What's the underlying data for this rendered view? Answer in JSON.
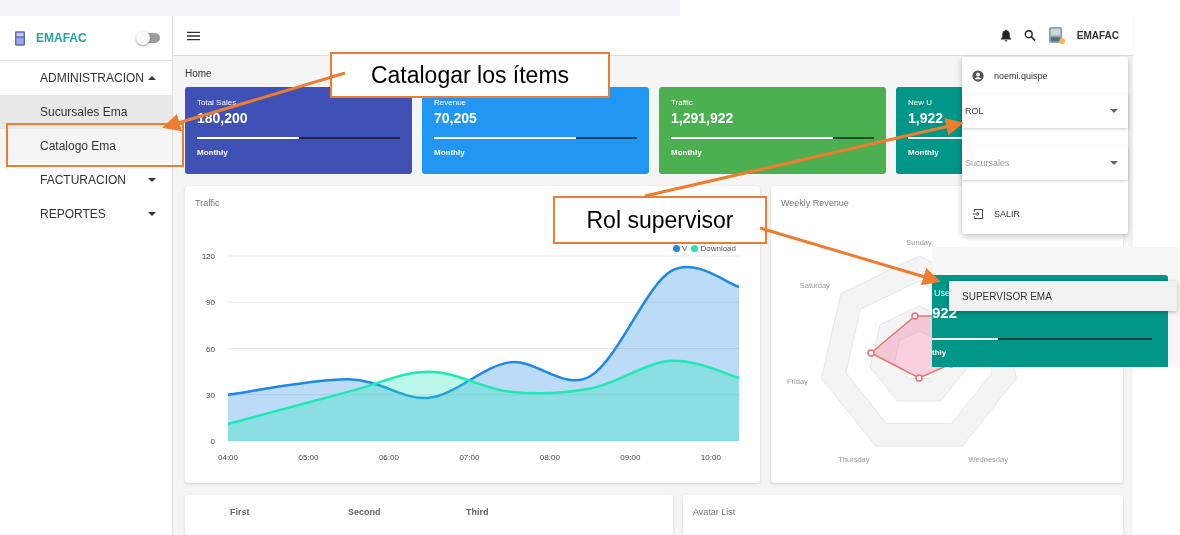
{
  "sidebar": {
    "brand": "EMAFAC",
    "toggle_on": false,
    "items": [
      {
        "label": "ADMINISTRACION",
        "expanded": true,
        "children": [
          {
            "label": "Sucursales Ema",
            "selected": true
          },
          {
            "label": "Catalogo Ema",
            "selected": false
          }
        ]
      },
      {
        "label": "FACTURACION",
        "expanded": false
      },
      {
        "label": "REPORTES",
        "expanded": false
      }
    ]
  },
  "topbar": {
    "user_label": "EMAFAC"
  },
  "breadcrumb": "Home",
  "stat_cards": [
    {
      "title": "Total Sales",
      "value": "180,200",
      "footer": "Monthly",
      "level": 0.5,
      "color": "#3f51b5"
    },
    {
      "title": "Revenue",
      "value": "70,205",
      "footer": "Monthly",
      "level": 0.7,
      "color": "#2196f3"
    },
    {
      "title": "Traffic",
      "value": "1,291,922",
      "footer": "Monthly",
      "level": 0.8,
      "color": "#4caf50"
    },
    {
      "title": "New U",
      "value": "1,922",
      "footer": "Monthly",
      "level": 0.5,
      "color": "#009688"
    }
  ],
  "traffic_card": {
    "title": "Traffic",
    "chart_data": {
      "type": "area",
      "x": [
        4,
        5.5,
        6.5,
        7.5,
        8.5,
        9.5,
        10.35
      ],
      "series": [
        {
          "name": "V",
          "color": "#1e88e5",
          "values": [
            30,
            40,
            28,
            51,
            42,
            110,
            100
          ]
        },
        {
          "name": "Download",
          "color": "#1de9b6",
          "values": [
            11,
            32,
            45,
            32,
            34,
            52,
            41
          ]
        }
      ],
      "grid": true,
      "ylim": [
        0,
        120
      ],
      "yticks": [
        0,
        30,
        60,
        90,
        120
      ],
      "xlim": [
        4,
        10.35
      ],
      "xticks": [
        {
          "value": 4,
          "label": "04:00"
        },
        {
          "value": 5,
          "label": "05:00"
        },
        {
          "value": 6,
          "label": "06:00"
        },
        {
          "value": 7,
          "label": "07:00"
        },
        {
          "value": 8,
          "label": "08:00"
        },
        {
          "value": 9,
          "label": "09:00"
        },
        {
          "value": 10,
          "label": "10:00"
        }
      ]
    }
  },
  "weekly_card": {
    "title": "Weekly Revenue",
    "axis_labels": [
      "Sunday",
      "Saturday",
      "Friday",
      "Thursday",
      "Wednesday"
    ]
  },
  "bottom_table": {
    "columns": [
      "First",
      "Second",
      "Third"
    ]
  },
  "avatar_card": {
    "title": "Avatar List"
  },
  "user_menu": {
    "username": "noemi.quispe",
    "fields": [
      {
        "placeholder": "ROL",
        "focused": true
      },
      {
        "placeholder": "Sucursales",
        "focused": false
      }
    ],
    "logout": "SALIR"
  },
  "inset": {
    "card_title": "Use",
    "card_value": "922",
    "card_footer": "thly",
    "level": 0.3,
    "option": "SUPERVISOR EMA"
  },
  "annotations": [
    {
      "text": "Catalogar los ítems"
    },
    {
      "text": "Rol supervisor"
    }
  ]
}
